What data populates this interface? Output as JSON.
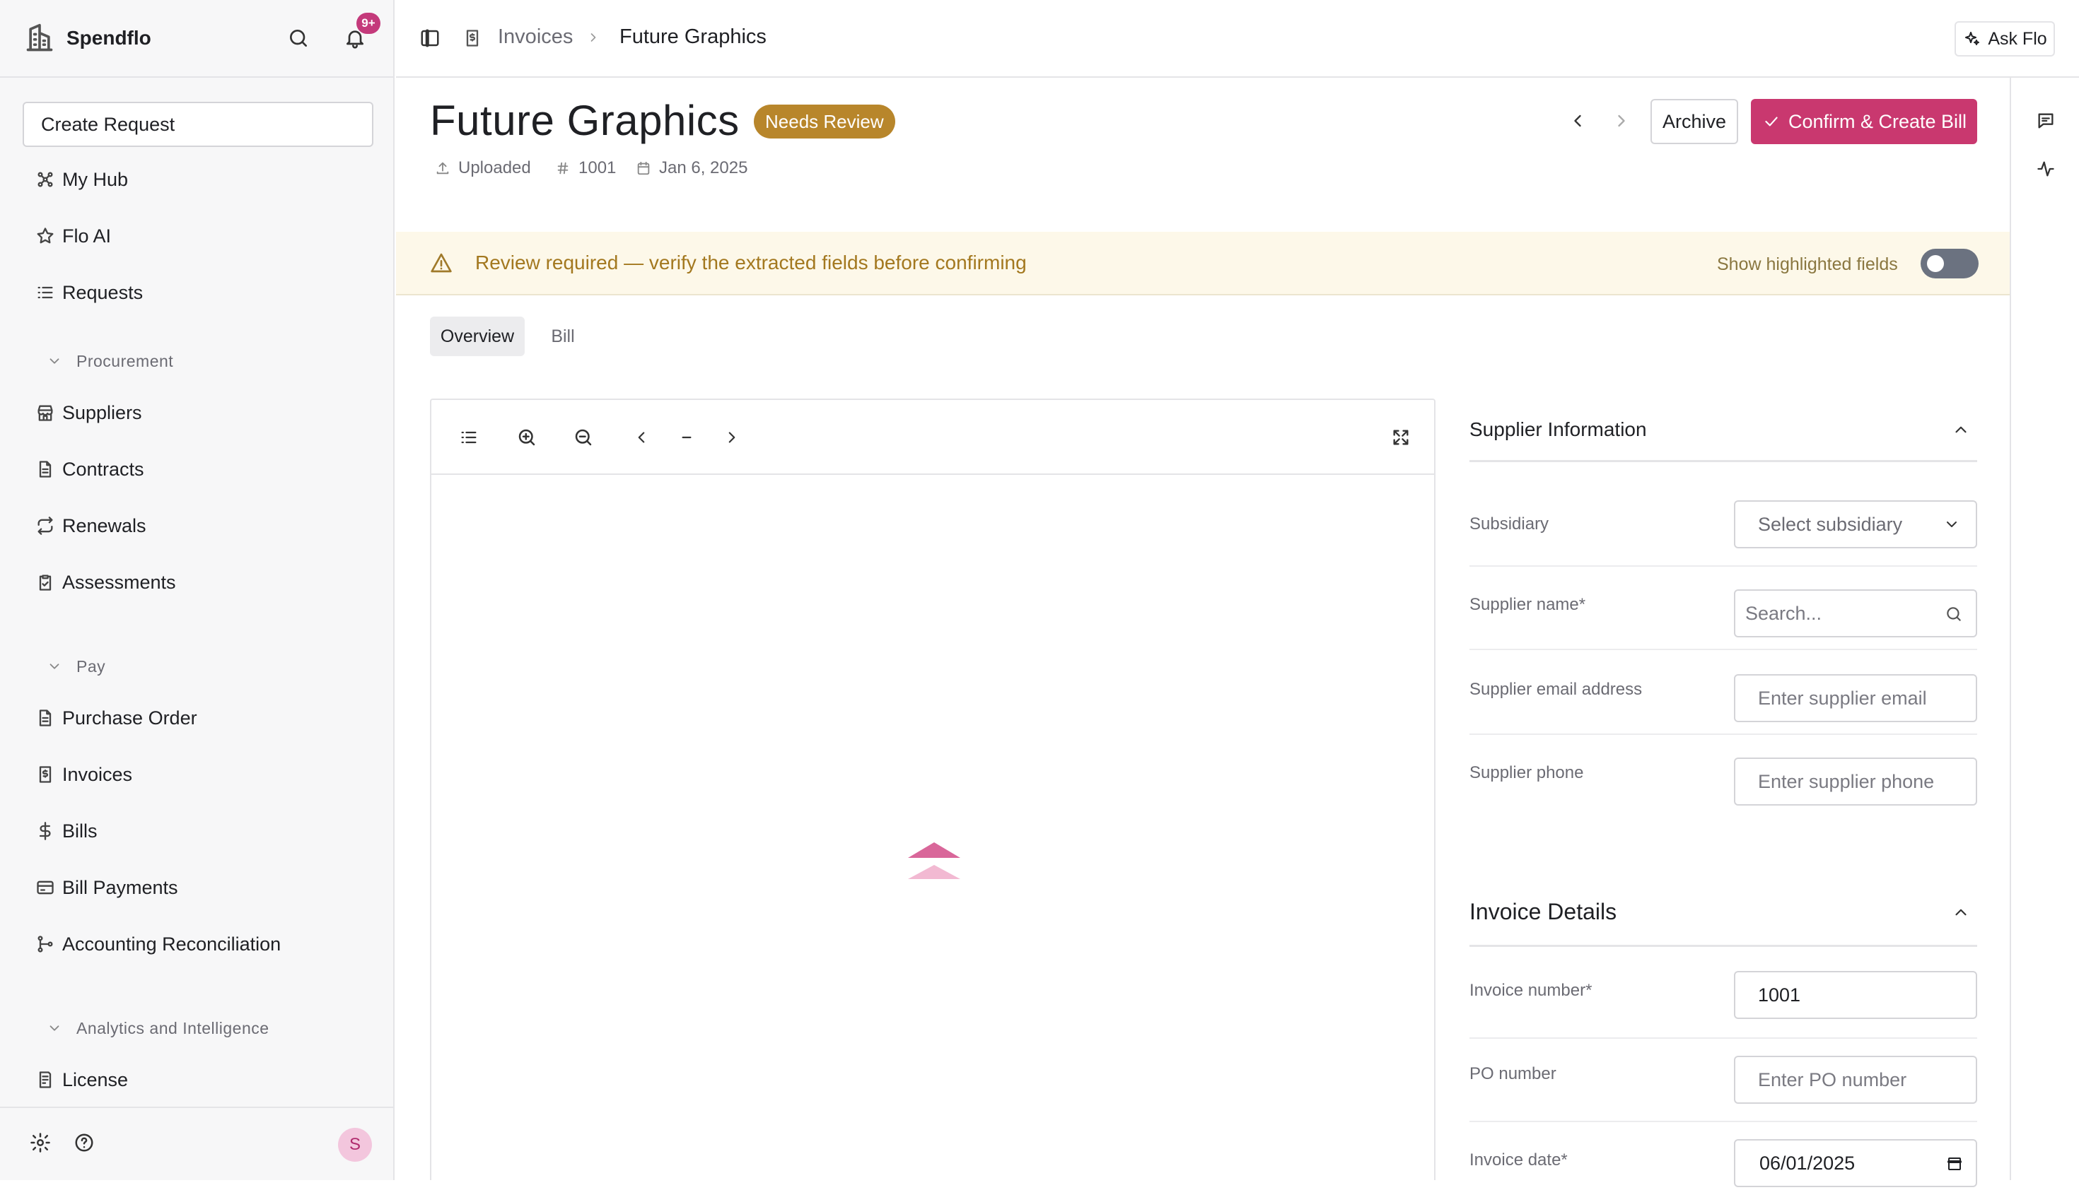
{
  "app": {
    "brand": "Spendflo",
    "notif_count": "9+",
    "user_initial": "S"
  },
  "sidebar": {
    "create_request": "Create Request",
    "items": [
      {
        "label": "My Hub"
      },
      {
        "label": "Flo AI"
      },
      {
        "label": "Requests"
      }
    ],
    "procurement": {
      "section": "Procurement",
      "items": [
        "Suppliers",
        "Contracts",
        "Renewals",
        "Assessments"
      ]
    },
    "pay": {
      "section": "Pay",
      "items": [
        "Purchase Order",
        "Invoices",
        "Bills",
        "Bill Payments",
        "Accounting Reconciliation"
      ]
    },
    "analytics": {
      "section": "Analytics and Intelligence",
      "items": [
        "License"
      ]
    }
  },
  "topbar": {
    "breadcrumb": [
      "Invoices",
      "Future Graphics"
    ],
    "ask_flo": "Ask Flo"
  },
  "header": {
    "title": "Future Graphics",
    "status": "Needs Review",
    "meta": {
      "source": "Uploaded",
      "number": "1001",
      "date": "Jan 6, 2025"
    },
    "archive": "Archive",
    "confirm": "Confirm & Create Bill"
  },
  "alert": {
    "text": "Review required — verify the extracted fields before confirming",
    "toggle_label": "Show highlighted fields",
    "toggle_on": false
  },
  "tabs": [
    "Overview",
    "Bill"
  ],
  "form": {
    "supplier_section": "Supplier Information",
    "subsidiary_label": "Subsidiary",
    "subsidiary_value": "Select subsidiary",
    "supplier_name_label": "Supplier name*",
    "supplier_name_placeholder": "Search...",
    "supplier_email_label": "Supplier email address",
    "supplier_email_placeholder": "Enter supplier email",
    "supplier_phone_label": "Supplier phone",
    "supplier_phone_placeholder": "Enter supplier phone",
    "invoice_section": "Invoice Details",
    "invoice_number_label": "Invoice number*",
    "invoice_number_value": "1001",
    "po_label": "PO number",
    "po_placeholder": "Enter PO number",
    "invoice_date_label": "Invoice date*",
    "invoice_date_value": "06/01/2025"
  },
  "colors": {
    "accent": "#c9386f",
    "status": "#b8862b",
    "alert_bg": "#fdf8e9"
  }
}
